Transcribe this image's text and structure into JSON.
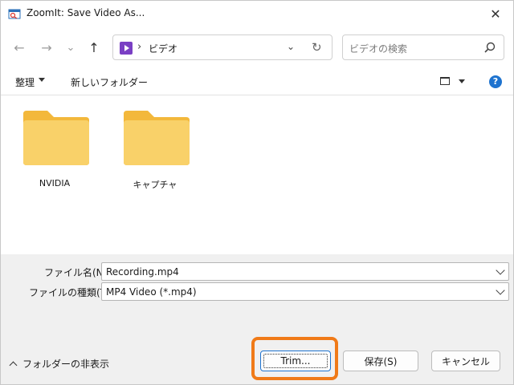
{
  "window": {
    "title": "ZoomIt: Save Video As...",
    "close_symbol": "✕"
  },
  "nav": {
    "back_symbol": "←",
    "forward_symbol": "→",
    "recent_symbol": "⌄",
    "up_symbol": "↑",
    "address": {
      "separator": "›",
      "current": "ビデオ",
      "dropdown_symbol": "⌄",
      "refresh_symbol": "↻"
    },
    "search": {
      "placeholder": "ビデオの検索"
    }
  },
  "toolbar": {
    "organize_label": "整理",
    "new_folder_label": "新しいフォルダー",
    "help_symbol": "?"
  },
  "folders": [
    {
      "label": "NVIDIA"
    },
    {
      "label": "キャプチャ"
    }
  ],
  "form": {
    "filename": {
      "label": "ファイル名(N):",
      "value": "Recording.mp4"
    },
    "filetype": {
      "label": "ファイルの種類(T):",
      "value": "MP4 Video (*.mp4)"
    }
  },
  "footer": {
    "hide_folders_label": "フォルダーの非表示",
    "trim_label": "Trim...",
    "save_label": "保存(S)",
    "cancel_label": "キャンセル"
  },
  "colors": {
    "highlight": "#f07a18",
    "folder": "#f7c95a",
    "accent": "#1e73cf"
  }
}
